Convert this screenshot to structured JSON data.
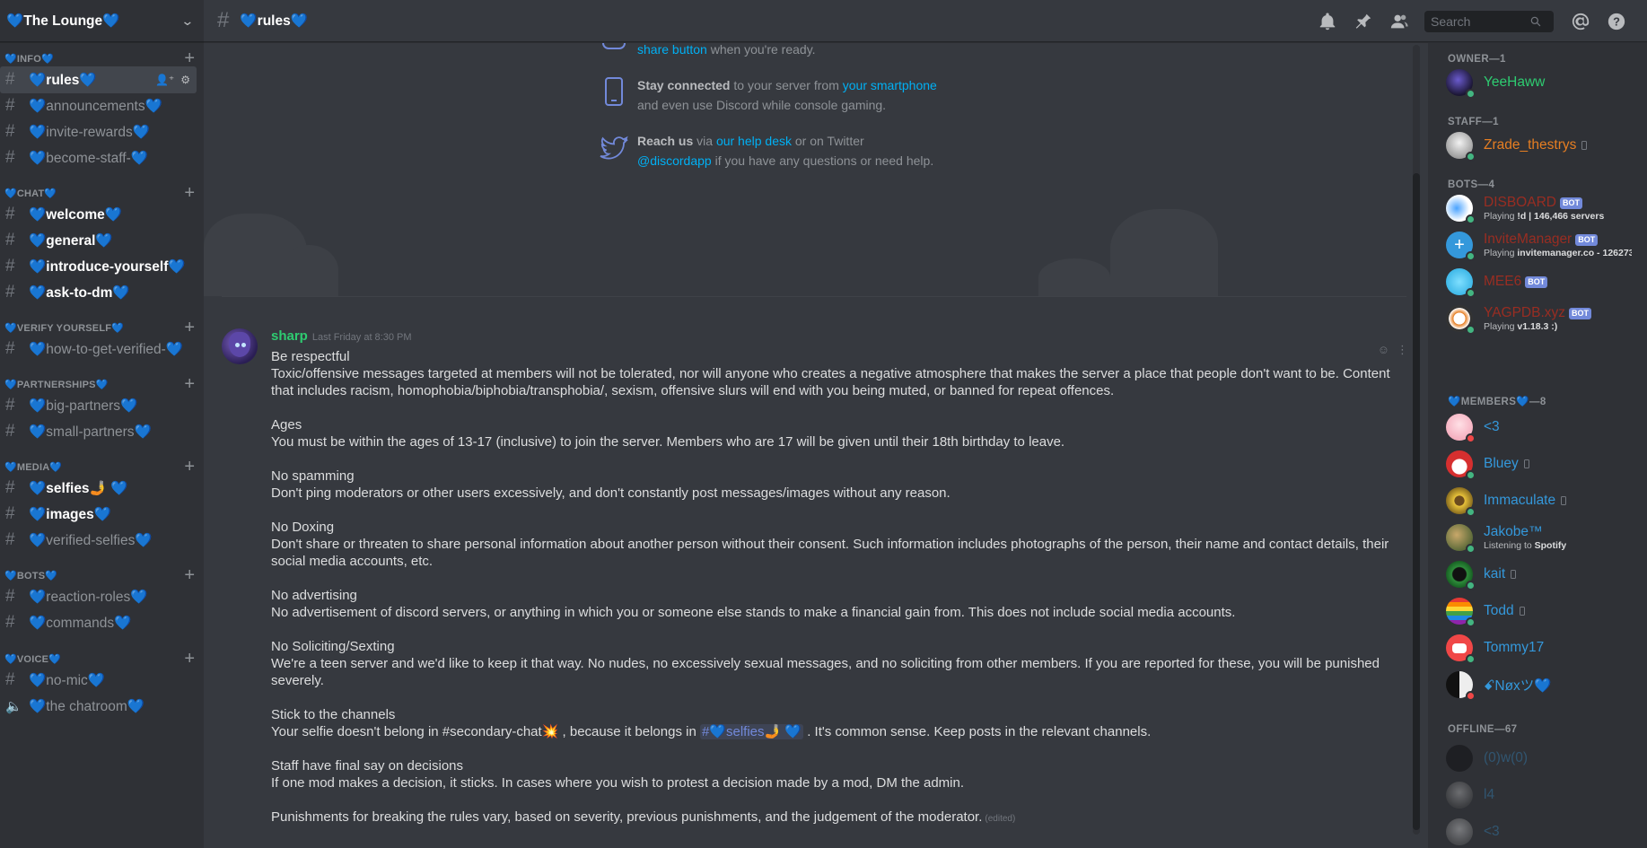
{
  "server": {
    "name": "💙The Lounge💙"
  },
  "channel": {
    "title": "💙rules💙"
  },
  "search": {
    "placeholder": "Search"
  },
  "sidebar": {
    "categories": [
      {
        "label": "💙INFO💙"
      },
      {
        "label": "💙CHAT💙"
      },
      {
        "label": "💙VERIFY YOURSELF💙"
      },
      {
        "label": "💙PARTNERSHIPS💙"
      },
      {
        "label": "💙MEDIA💙"
      },
      {
        "label": "💙BOTS💙"
      },
      {
        "label": "💙VOICE💙"
      }
    ],
    "channels": [
      {
        "name": "💙rules💙"
      },
      {
        "name": "💙announcements💙"
      },
      {
        "name": "💙invite-rewards💙"
      },
      {
        "name": "💙become-staff-💙"
      },
      {
        "name": "💙welcome💙"
      },
      {
        "name": "💙general💙"
      },
      {
        "name": "💙introduce-yourself💙"
      },
      {
        "name": "💙ask-to-dm💙"
      },
      {
        "name": "💙how-to-get-verified-💙"
      },
      {
        "name": "💙big-partners💙"
      },
      {
        "name": "💙small-partners💙"
      },
      {
        "name": "💙selfies🤳 💙"
      },
      {
        "name": "💙images💙"
      },
      {
        "name": "💙verified-selfies💙"
      },
      {
        "name": "💙reaction-roles💙"
      },
      {
        "name": "💙commands💙"
      },
      {
        "name": "💙no-mic💙"
      },
      {
        "name": "💙the chatroom💙"
      }
    ]
  },
  "tips": {
    "t1": {
      "link": "share button",
      "rest": " when you're ready."
    },
    "t2": {
      "strong": "Stay connected",
      "mid": " to your server from ",
      "link": "your smartphone",
      "line2": "and even use Discord while console gaming."
    },
    "t3": {
      "strong": "Reach us",
      "mid": " via ",
      "link": "our help desk",
      "rest": " or on Twitter",
      "link2": "@discordapp",
      "rest2": " if you have any questions or need help."
    }
  },
  "message": {
    "author": "sharp",
    "timestamp": "Last Friday at 8:30 PM",
    "sections": [
      {
        "title": "Be respectful",
        "body": "Toxic/offensive messages targeted at members will not be tolerated, nor will anyone who creates a negative atmosphere that makes the server a place that people don't want to be. Content that includes racism, homophobia/biphobia/transphobia/, sexism, offensive slurs will end with you being muted, or banned for repeat offences."
      },
      {
        "title": "Ages",
        "body": "You must be within the ages of 13-17 (inclusive) to join the server. Members who are 17 will be given until their 18th birthday to leave."
      },
      {
        "title": "No spamming",
        "body": "Don't ping moderators or other users excessively, and don't constantly post messages/images without any reason."
      },
      {
        "title": "No Doxing",
        "body": "Don't share or threaten to share personal information about another person without their consent. Such information includes photographs of the person, their name and contact details, their social media accounts, etc."
      },
      {
        "title": "No advertising",
        "body": "No advertisement of discord servers, or anything in which you or someone else stands to make a financial gain from. This does not include social media accounts."
      },
      {
        "title": "No Soliciting/Sexting",
        "body": "We're a teen server and we'd like to keep it that way. No nudes, no excessively sexual messages, and no soliciting from other members. If you are reported for these, you will be punished severely."
      },
      {
        "title": "Stick to the channels",
        "body_pre": "Your selfie doesn't belong in #secondary-chat💥 , because it belongs in ",
        "mention": "#💙selfies🤳 💙",
        "body_post": " . It's common sense. Keep posts in the relevant channels."
      },
      {
        "title": "Staff have final say on decisions",
        "body": "If one mod makes a decision, it sticks. In cases where you wish to protest a decision made by a mod, DM the admin."
      }
    ],
    "closing": "Punishments for breaking the rules vary, based on severity, previous punishments, and the judgement of the moderator.",
    "edited": "(edited)"
  },
  "members": {
    "groups": [
      {
        "label": "OWNER—1"
      },
      {
        "label": "STAFF—1"
      },
      {
        "label": "BOTS—4"
      },
      {
        "label": "💙MEMBERS💙—8"
      },
      {
        "label": "OFFLINE—67"
      }
    ],
    "list": [
      {
        "name": "YeeHaww",
        "color": "#2ecc71"
      },
      {
        "name": "Zrade_thestrys",
        "color": "#e67e22"
      },
      {
        "name": "DISBOARD",
        "color": "#992d22",
        "tag": "BOT",
        "activity_pre": "Playing ",
        "activity": "!d | 146,466 servers"
      },
      {
        "name": "InviteManager",
        "color": "#992d22",
        "tag": "BOT",
        "activity_pre": "Playing ",
        "activity": "invitemanager.co - 126273..."
      },
      {
        "name": "MEE6",
        "color": "#992d22",
        "tag": "BOT"
      },
      {
        "name": "YAGPDB.xyz",
        "color": "#992d22",
        "tag": "BOT",
        "activity_pre": "Playing ",
        "activity": "v1.18.3 :)"
      },
      {
        "name": "<3",
        "color": "#3498db"
      },
      {
        "name": "Bluey",
        "color": "#3498db"
      },
      {
        "name": "Immaculate",
        "color": "#3498db"
      },
      {
        "name": "Jakobe™",
        "color": "#3498db",
        "activity_pre": "Listening to ",
        "activity": "Spotify"
      },
      {
        "name": "kait",
        "color": "#3498db"
      },
      {
        "name": "Todd",
        "color": "#3498db"
      },
      {
        "name": "Tommy17",
        "color": "#3498db"
      },
      {
        "name": "ꗃNøxツ💙",
        "color": "#3498db"
      },
      {
        "name": "(0)w(0)",
        "color": "#3498db"
      },
      {
        "name": "l4",
        "color": "#3498db"
      },
      {
        "name": "<3",
        "color": "#3498db"
      }
    ]
  },
  "colors": {
    "accent": "#7289da",
    "link": "#00b0f4",
    "online": "#43b581",
    "dnd": "#f04747"
  }
}
